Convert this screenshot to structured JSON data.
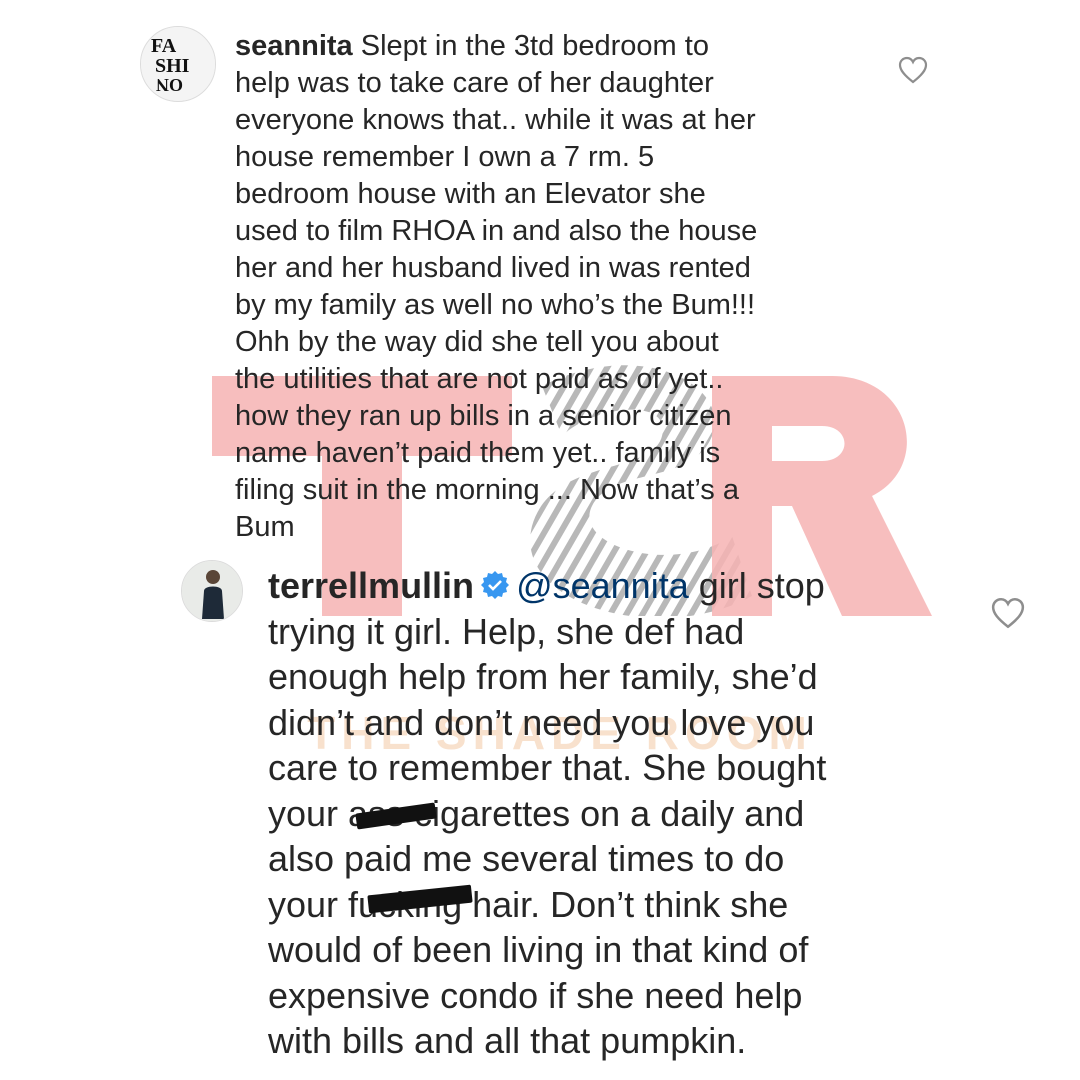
{
  "watermark": {
    "logo_letters": "TSR",
    "text": "THE SHADE ROOM",
    "color": "#f4a7a7"
  },
  "comments": [
    {
      "username": "seannita",
      "avatar_letters": "FA SHI ON",
      "text": "Slept in the 3td bedroom to\nhelp was to take care of her daughter\neveryone knows that.. while it was at her\nhouse remember I own a 7 rm. 5\nbedroom house with an Elevator she\nused to film RHOA in and also the house\nher and her husband lived  in was rented\nby my family as well no who’s the Bum!!!\nOhh by the way did she tell you about\nthe utilities that are not paid as of yet..\nhow they ran up bills in a senior citizen\nname haven’t paid them yet.. family is\nfiling suit in the morning ... Now that’s a\nBum",
      "like_icon": "heart-outline-icon"
    },
    {
      "username": "terrellmullin",
      "verified_icon": "verified-badge-icon",
      "mention": "@seannita",
      "text_first_line": "girl stop",
      "text": "trying it girl. Help, she def had\nenough help from her family, she’d\ndidn’t and don’t need you love you\ncare to remember that.  She bought\nyour ass cigarettes on a daily and\nalso paid me several times to do\nyour fucking hair. Don’t think she\nwould of been living in that kind of\nexpensive condo if she need help\nwith bills and all that pumpkin.",
      "like_icon": "heart-outline-icon"
    }
  ],
  "colors": {
    "text": "#262626",
    "mention": "#003569",
    "verified": "#3897f0",
    "heart": "#8e8e8e"
  }
}
